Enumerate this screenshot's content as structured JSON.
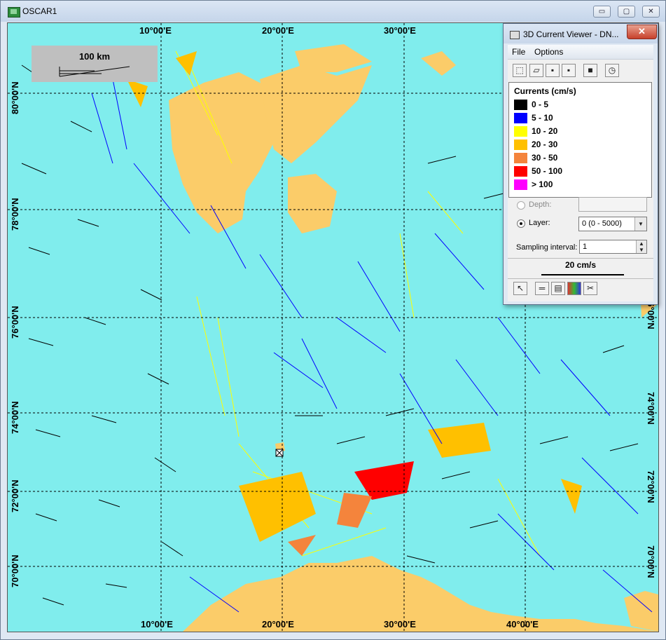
{
  "main_window": {
    "title": "OSCAR1",
    "minimize_glyph": "▭",
    "maximize_glyph": "▢",
    "close_glyph": "✕"
  },
  "map": {
    "lon_labels_top": [
      "10°00'E",
      "20°00'E",
      "30°00'E"
    ],
    "lon_labels_bottom": [
      "10°00'E",
      "20°00'E",
      "30°00'E",
      "40°00'E"
    ],
    "lat_labels_left": [
      "80°00'N",
      "78°00'N",
      "76°00'N",
      "74°00'N",
      "72°00'N",
      "70°00'N"
    ],
    "lat_labels_right": [
      "76°00'N",
      "74°00'N",
      "72°00'N",
      "70°00'N"
    ],
    "scale_bar_label": "100 km",
    "colors": {
      "ocean": "#80eded",
      "land": "#fbcc69",
      "grid": "#000000"
    }
  },
  "viewer": {
    "title": "3D Current Viewer - DN...",
    "close_glyph": "✕",
    "menu": [
      "File",
      "Options"
    ],
    "toolbar_icons": [
      "select-icon",
      "open-folder-icon",
      "save-icon",
      "save-all-icon",
      "stop-icon",
      "clock-icon"
    ],
    "legend": {
      "title": "Currents (cm/s)",
      "items": [
        {
          "label": "0 -  5",
          "color": "#000000"
        },
        {
          "label": "5 - 10",
          "color": "#0000ff"
        },
        {
          "label": "10 - 20",
          "color": "#ffff00"
        },
        {
          "label": "20 - 30",
          "color": "#ffc000"
        },
        {
          "label": "30 - 50",
          "color": "#f4843c"
        },
        {
          "label": "50 - 100",
          "color": "#ff0000"
        },
        {
          "label": "> 100",
          "color": "#ff00ff"
        }
      ]
    },
    "depth_label": "Depth:",
    "layer_label": "Layer:",
    "layer_value": "0 (0 - 5000)",
    "sampling_label": "Sampling interval:",
    "sampling_value": "1",
    "vector_scale_label": "20 cm/s",
    "bottom_tools": [
      "pointer-icon",
      "ruler-icon",
      "film-icon",
      "grid-color-icon",
      "scissors-icon"
    ]
  }
}
